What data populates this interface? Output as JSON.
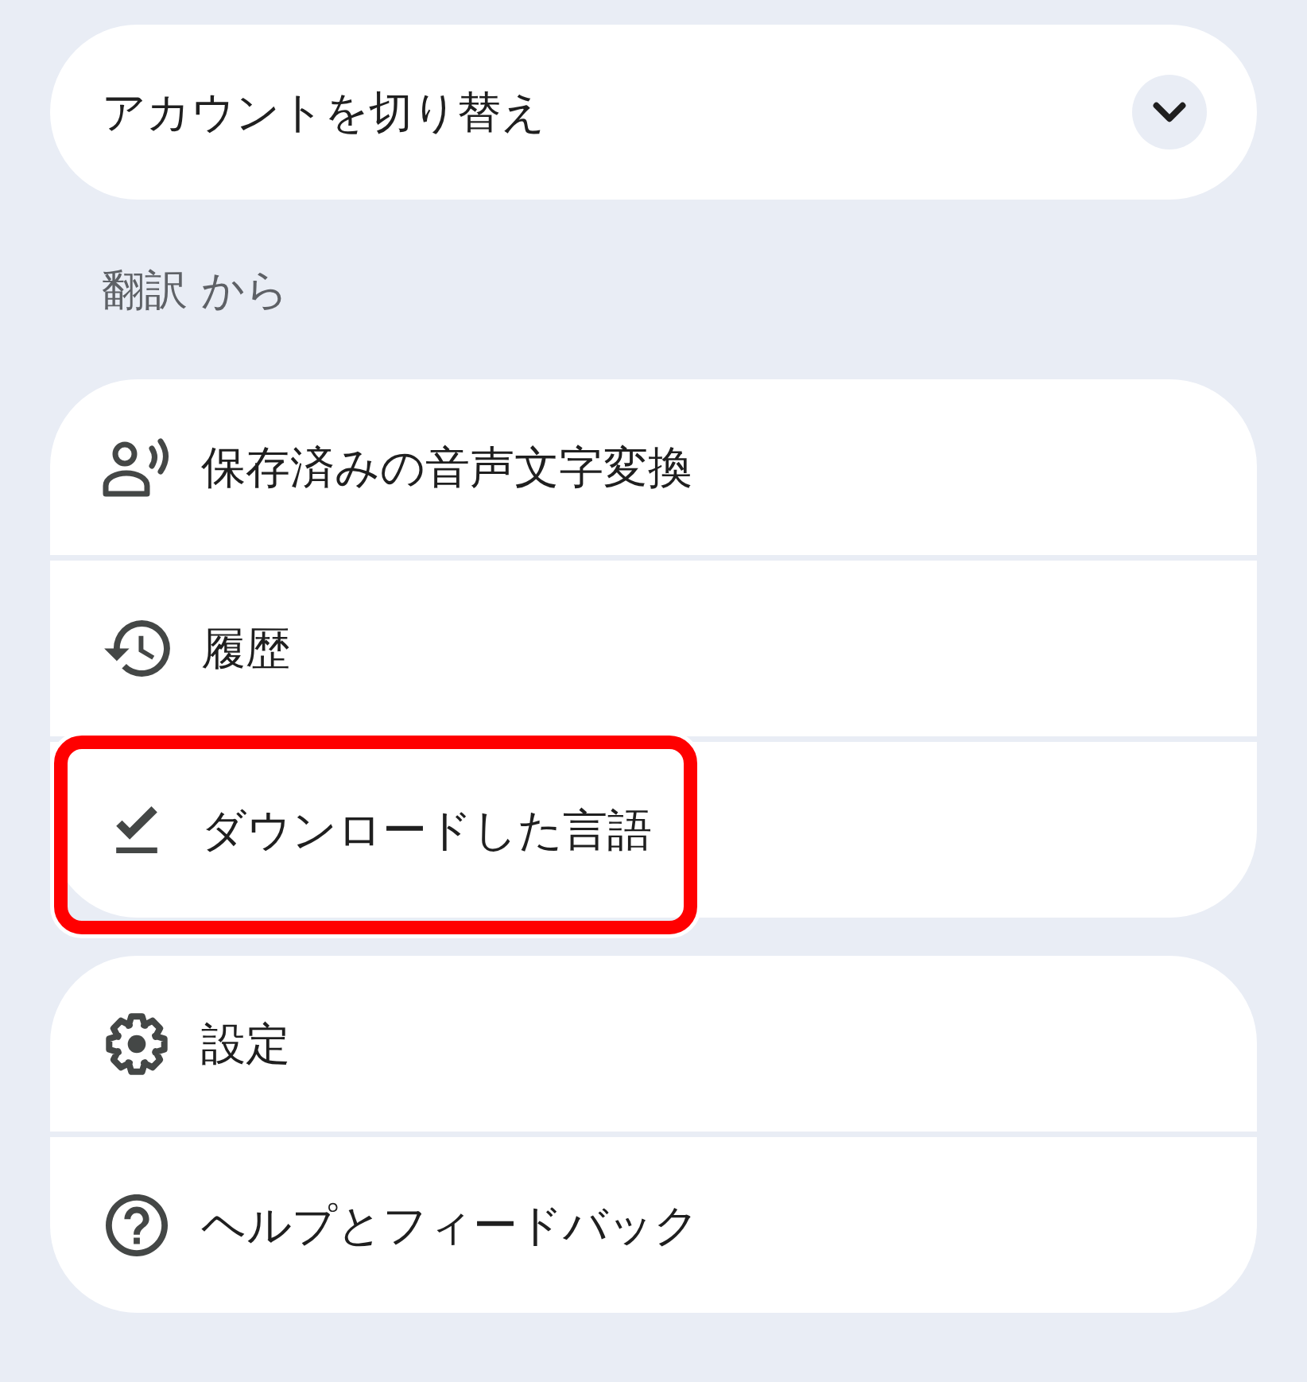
{
  "account_switcher": {
    "label": "アカウントを切り替え",
    "expanded": false
  },
  "section_title": "翻訳 から",
  "menu_groups": [
    {
      "items": [
        {
          "kind": "transcripts",
          "label": "保存済みの音声文字変換",
          "highlighted": false
        },
        {
          "kind": "history",
          "label": "履歴",
          "highlighted": false
        },
        {
          "kind": "downloads",
          "label": "ダウンロードした言語",
          "highlighted": true
        }
      ]
    },
    {
      "items": [
        {
          "kind": "settings",
          "label": "設定",
          "highlighted": false
        },
        {
          "kind": "help",
          "label": "ヘルプとフィードバック",
          "highlighted": false
        }
      ]
    }
  ]
}
